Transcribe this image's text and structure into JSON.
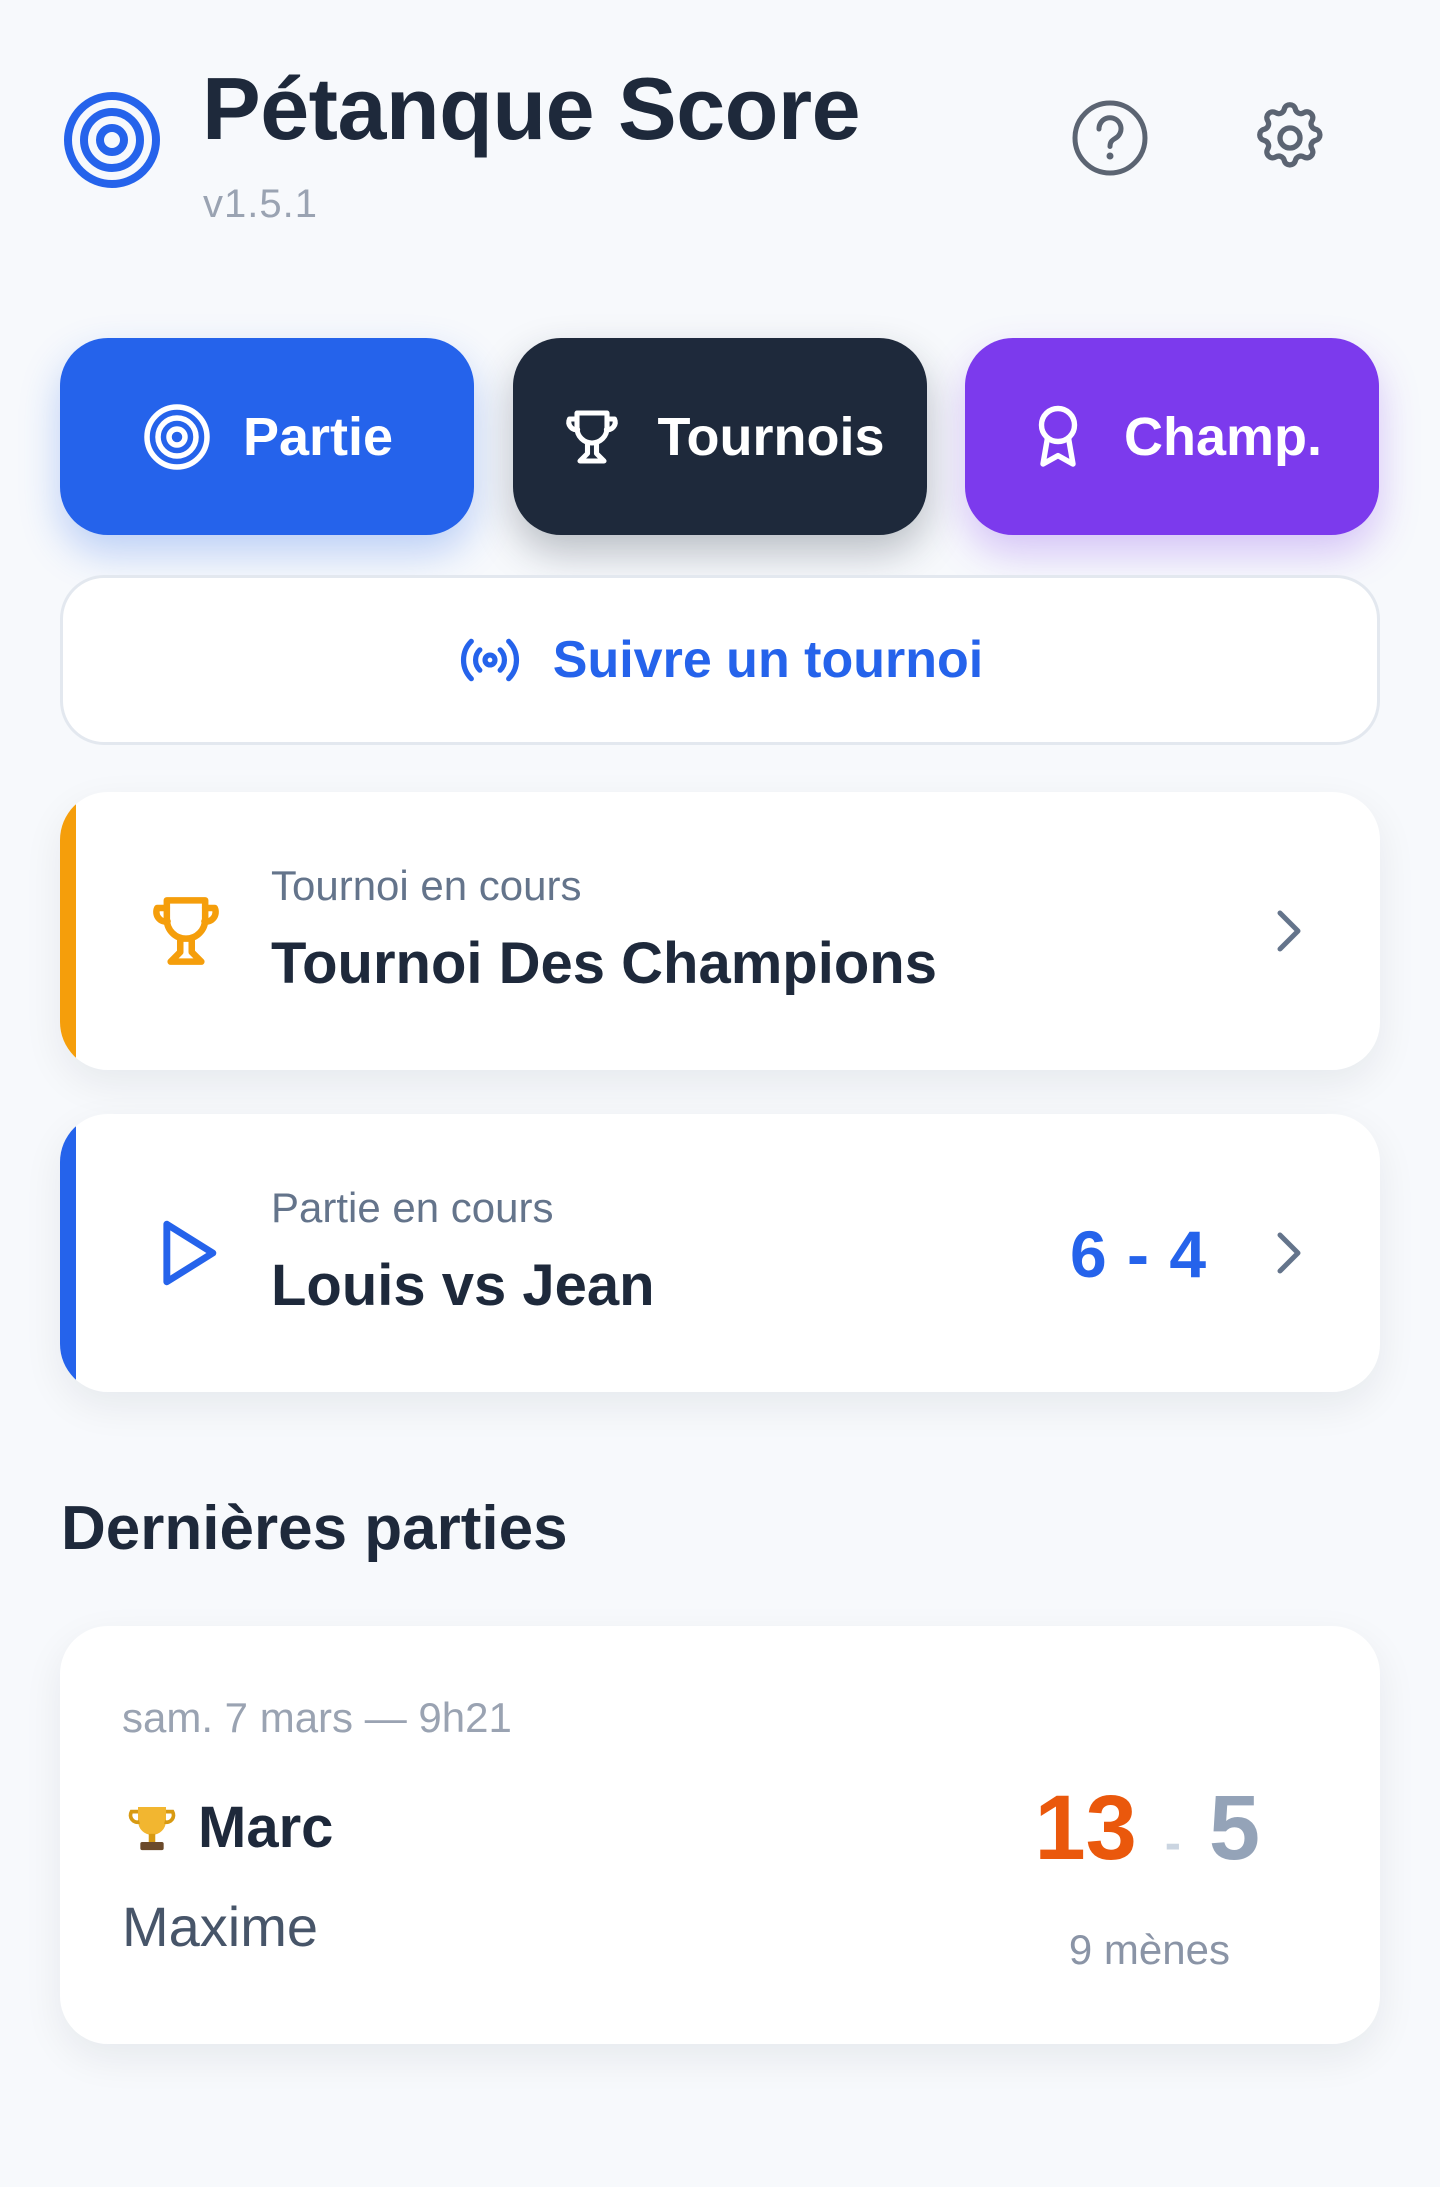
{
  "app": {
    "title": "Pétanque Score",
    "version": "v1.5.1",
    "icons": {
      "logo": "target-logo-icon",
      "help": "help-circle-icon",
      "settings": "gear-icon"
    }
  },
  "modes": [
    {
      "label": "Partie",
      "icon": "target-icon",
      "color": "#2563eb"
    },
    {
      "label": "Tournois",
      "icon": "trophy-icon",
      "color": "#1e293b"
    },
    {
      "label": "Champ.",
      "icon": "award-icon",
      "color": "#7c3aed"
    }
  ],
  "follow": {
    "label": "Suivre un tournoi",
    "icon": "broadcast-icon"
  },
  "current_tournament": {
    "subtitle": "Tournoi en cours",
    "title": "Tournoi Des Champions",
    "accent": "#f59e0b"
  },
  "current_match": {
    "subtitle": "Partie en cours",
    "title": "Louis vs Jean",
    "score": "6 - 4",
    "accent": "#2563eb"
  },
  "recent": {
    "section_title": "Dernières parties",
    "matches": [
      {
        "date": "sam. 7 mars — 9h21",
        "winner": "Marc",
        "loser": "Maxime",
        "winner_score": "13",
        "separator": "-",
        "loser_score": "5",
        "menes": "9 mènes"
      }
    ]
  }
}
